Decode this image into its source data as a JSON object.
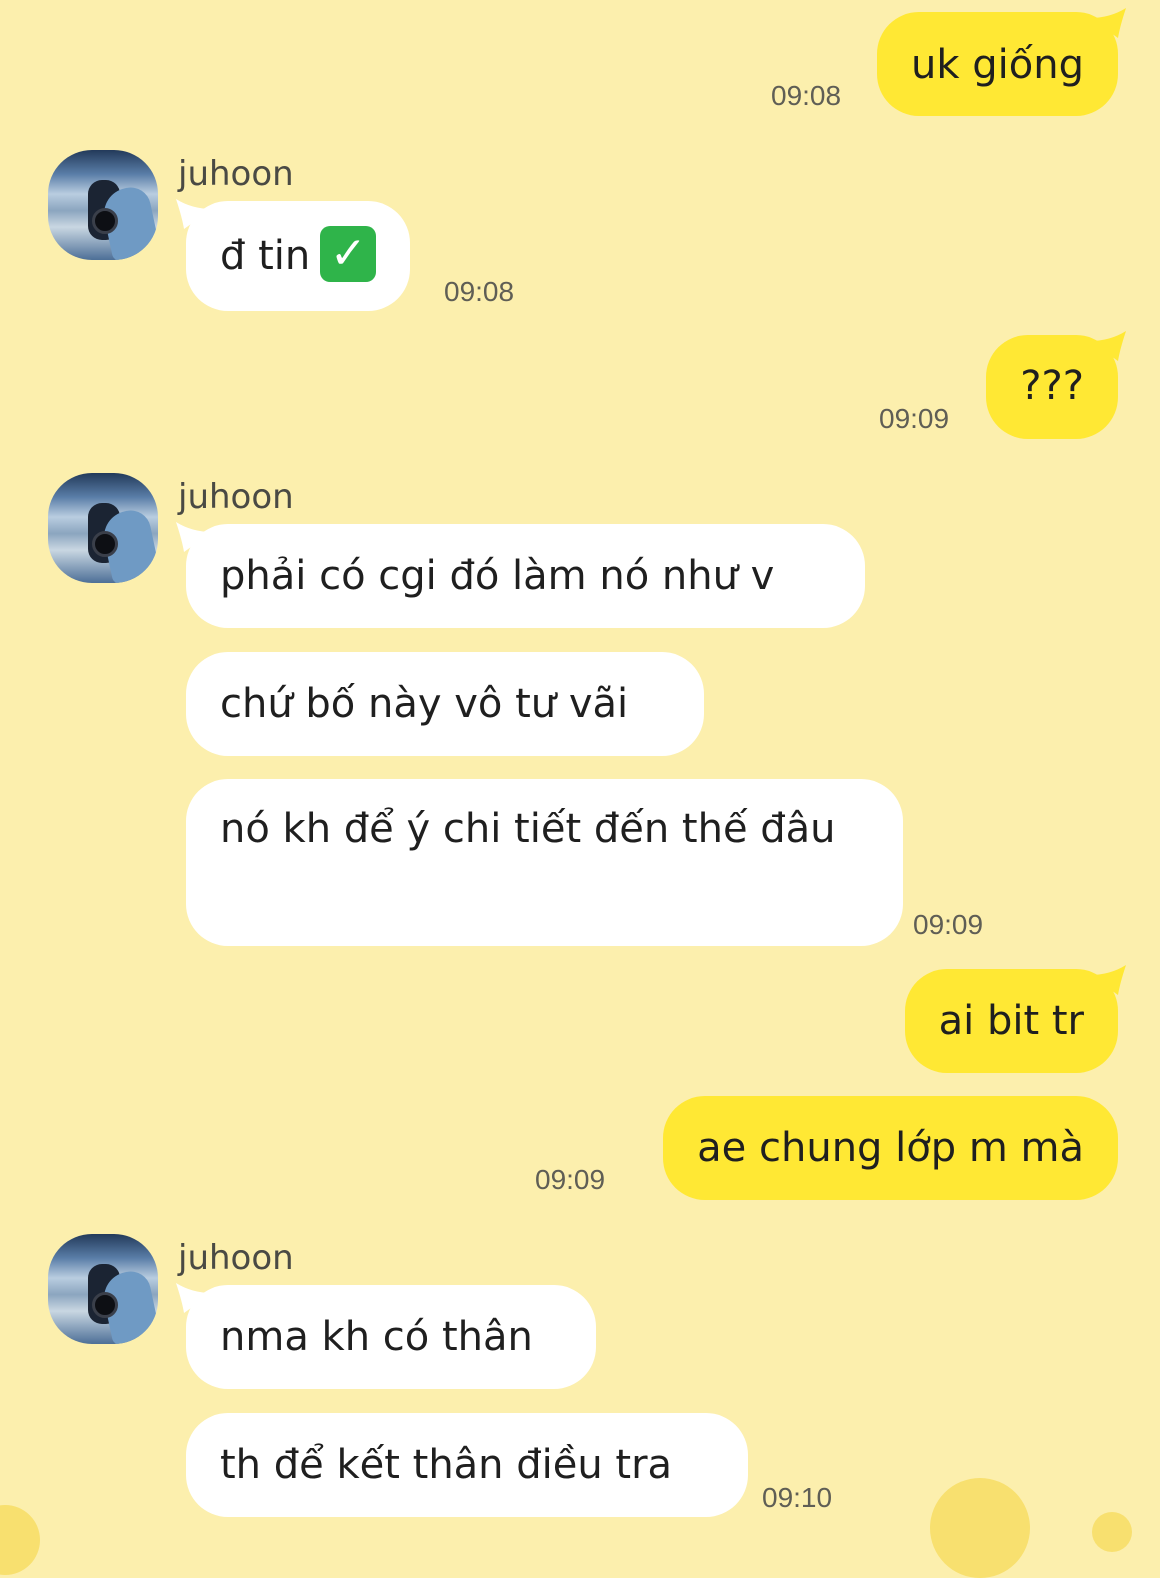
{
  "chat": {
    "contact_name": "juhoon",
    "messages": [
      {
        "side": "out",
        "text": "uk giống",
        "time": "09:08"
      },
      {
        "side": "in",
        "text": "đ tin",
        "time": "09:08"
      },
      {
        "side": "out",
        "text": "???",
        "time": "09:09"
      },
      {
        "side": "in",
        "text": "phải có cgi đó làm nó như v"
      },
      {
        "side": "in",
        "text": "chứ bố này vô tư vãi"
      },
      {
        "side": "in",
        "text": "nó kh để ý chi tiết đến thế đâu",
        "time": "09:09"
      },
      {
        "side": "out",
        "text": "ai bit tr"
      },
      {
        "side": "out",
        "text": "ae chung lớp m mà",
        "time": "09:09"
      },
      {
        "side": "in",
        "text": "nma kh có thân"
      },
      {
        "side": "in",
        "text": "th để kết thân điều tra",
        "time": "09:10"
      }
    ],
    "check_emoji": "✓",
    "icons": [
      "check-mark-emoji-icon",
      "avatar"
    ],
    "colors": {
      "background": "#fcefad",
      "outgoing_bubble": "#ffe834",
      "incoming_bubble": "#ffffff",
      "timestamp": "#5f5e55"
    }
  }
}
